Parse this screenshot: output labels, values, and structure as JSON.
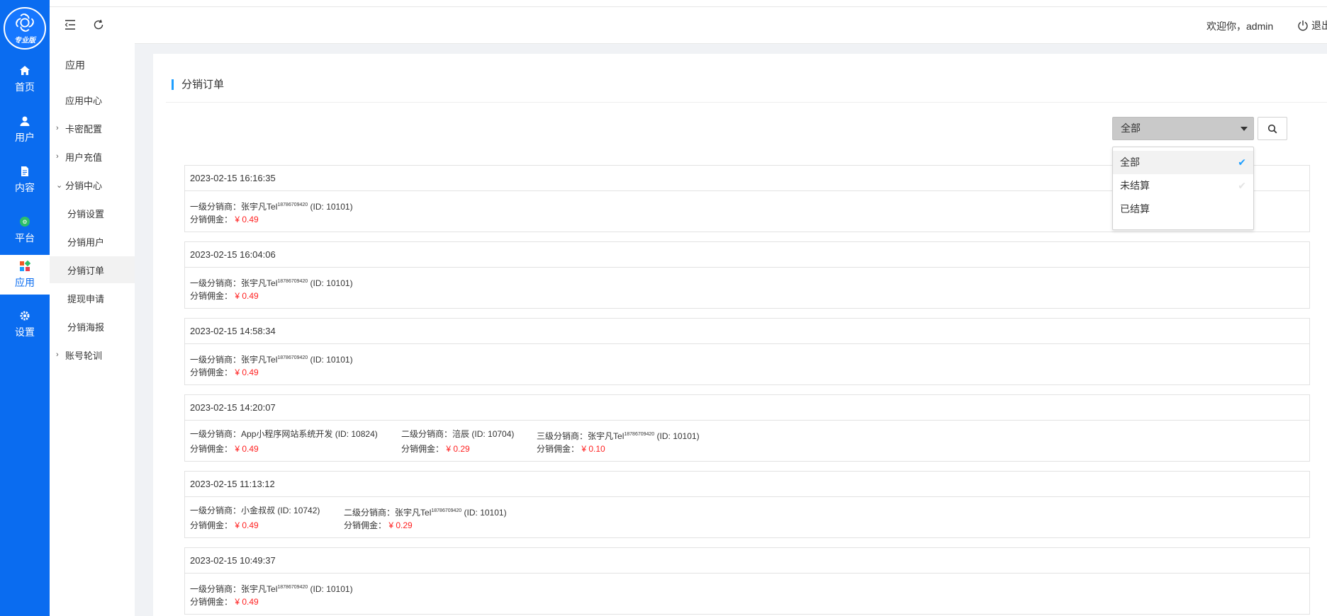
{
  "rail": {
    "logo_badge": "专业版",
    "items": [
      {
        "label": "首页",
        "icon": "home-icon"
      },
      {
        "label": "用户",
        "icon": "user-icon"
      },
      {
        "label": "内容",
        "icon": "document-icon"
      },
      {
        "label": "平台",
        "icon": "platform-icon"
      },
      {
        "label": "应用",
        "icon": "apps-icon",
        "active": true
      },
      {
        "label": "设置",
        "icon": "gear-icon"
      }
    ]
  },
  "subnav": {
    "title": "应用",
    "items": [
      {
        "label": "应用中心",
        "level": 1
      },
      {
        "label": "卡密配置",
        "level": 1,
        "caret": "›"
      },
      {
        "label": "用户充值",
        "level": 1,
        "caret": "›"
      },
      {
        "label": "分销中心",
        "level": 1,
        "caret": "⌄"
      },
      {
        "label": "分销设置",
        "level": 2
      },
      {
        "label": "分销用户",
        "level": 2
      },
      {
        "label": "分销订单",
        "level": 2,
        "active": true
      },
      {
        "label": "提现申请",
        "level": 2
      },
      {
        "label": "分销海报",
        "level": 2
      },
      {
        "label": "账号轮训",
        "level": 1,
        "caret": "›"
      }
    ]
  },
  "header": {
    "welcome": "欢迎你，admin",
    "logout": "退出"
  },
  "panel": {
    "title": "分销订单"
  },
  "filter": {
    "selected": "全部",
    "options": [
      "全部",
      "未结算",
      "已结算"
    ]
  },
  "labels": {
    "level1": "一级分销商：",
    "level2": "二级分销商：",
    "level3": "三级分销商：",
    "commission": "分销佣金："
  },
  "orders": [
    {
      "time": "2023-02-15 16:16:35",
      "distributors": [
        {
          "name": "张宇凡",
          "tel": "Tel",
          "phone": "18786709420",
          "id": "(ID: 10101)",
          "commission": "¥ 0.49"
        }
      ]
    },
    {
      "time": "2023-02-15 16:04:06",
      "distributors": [
        {
          "name": "张宇凡",
          "tel": "Tel",
          "phone": "18786709420",
          "id": "(ID: 10101)",
          "commission": "¥ 0.49"
        }
      ]
    },
    {
      "time": "2023-02-15 14:58:34",
      "distributors": [
        {
          "name": "张宇凡",
          "tel": "Tel",
          "phone": "18786709420",
          "id": "(ID: 10101)",
          "commission": "¥ 0.49"
        }
      ]
    },
    {
      "time": "2023-02-15 14:20:07",
      "distributors": [
        {
          "name": "App小程序网站系统开发",
          "tel": "",
          "phone": "",
          "id": "(ID: 10824)",
          "commission": "¥ 0.49"
        },
        {
          "name": "涪辰",
          "tel": "",
          "phone": "",
          "id": "(ID: 10704)",
          "commission": "¥ 0.29"
        },
        {
          "name": "张宇凡",
          "tel": "Tel",
          "phone": "18786709420",
          "id": "(ID: 10101)",
          "commission": "¥ 0.10"
        }
      ]
    },
    {
      "time": "2023-02-15 11:13:12",
      "distributors": [
        {
          "name": "小金叔叔",
          "tel": "",
          "phone": "",
          "id": "(ID: 10742)",
          "commission": "¥ 0.49"
        },
        {
          "name": "张宇凡",
          "tel": "Tel",
          "phone": "18786709420",
          "id": "(ID: 10101)",
          "commission": "¥ 0.29"
        }
      ]
    },
    {
      "time": "2023-02-15 10:49:37",
      "distributors": [
        {
          "name": "张宇凡",
          "tel": "Tel",
          "phone": "18786709420",
          "id": "(ID: 10101)",
          "commission": "¥ 0.49"
        }
      ]
    }
  ],
  "colors": {
    "primary": "#0a6cf0",
    "accent": "#1e9fff",
    "money": "#ff2222"
  }
}
